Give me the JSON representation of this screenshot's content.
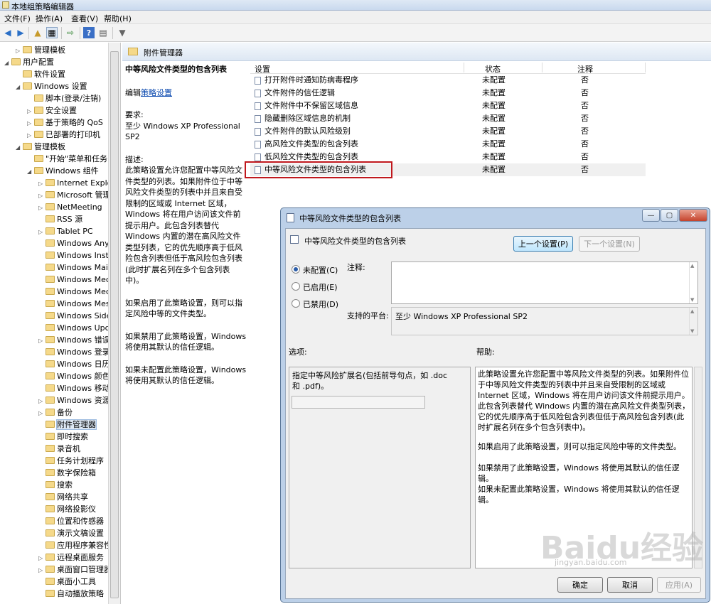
{
  "window": {
    "title": "本地组策略编辑器"
  },
  "menu": [
    "文件(F)",
    "操作(A)",
    "查看(V)",
    "帮助(H)"
  ],
  "toolbar_icons": [
    "back-arrow-icon",
    "forward-arrow-icon",
    "up-folder-icon",
    "show-hide-tree-icon",
    "export-list-icon",
    "help-icon",
    "properties-icon",
    "filter-icon"
  ],
  "tree": [
    {
      "label": "管理模板",
      "level": 1,
      "exp": "▷"
    },
    {
      "label": "用户配置",
      "level": 0,
      "exp": "◢"
    },
    {
      "label": "软件设置",
      "level": 1,
      "exp": ""
    },
    {
      "label": "Windows 设置",
      "level": 1,
      "exp": "◢"
    },
    {
      "label": "脚本(登录/注销)",
      "level": 2,
      "exp": ""
    },
    {
      "label": "安全设置",
      "level": 2,
      "exp": "▷"
    },
    {
      "label": "基于策略的 QoS",
      "level": 2,
      "exp": "▷"
    },
    {
      "label": "已部署的打印机",
      "level": 2,
      "exp": "▷"
    },
    {
      "label": "管理模板",
      "level": 1,
      "exp": "◢"
    },
    {
      "label": "\"开始\"菜单和任务",
      "level": 2,
      "exp": ""
    },
    {
      "label": "Windows 组件",
      "level": 2,
      "exp": "◢"
    },
    {
      "label": "Internet Explor",
      "level": 3,
      "exp": "▷"
    },
    {
      "label": "Microsoft 管理",
      "level": 3,
      "exp": "▷"
    },
    {
      "label": "NetMeeting",
      "level": 3,
      "exp": "▷"
    },
    {
      "label": "RSS 源",
      "level": 3,
      "exp": ""
    },
    {
      "label": "Tablet PC",
      "level": 3,
      "exp": "▷"
    },
    {
      "label": "Windows Anyt",
      "level": 3,
      "exp": ""
    },
    {
      "label": "Windows Insta",
      "level": 3,
      "exp": ""
    },
    {
      "label": "Windows Mail",
      "level": 3,
      "exp": ""
    },
    {
      "label": "Windows Med",
      "level": 3,
      "exp": ""
    },
    {
      "label": "Windows Med",
      "level": 3,
      "exp": ""
    },
    {
      "label": "Windows Mes",
      "level": 3,
      "exp": ""
    },
    {
      "label": "Windows Side",
      "level": 3,
      "exp": ""
    },
    {
      "label": "Windows Upd",
      "level": 3,
      "exp": ""
    },
    {
      "label": "Windows 错误",
      "level": 3,
      "exp": "▷"
    },
    {
      "label": "Windows 登录",
      "level": 3,
      "exp": ""
    },
    {
      "label": "Windows 日历",
      "level": 3,
      "exp": ""
    },
    {
      "label": "Windows 颜色",
      "level": 3,
      "exp": ""
    },
    {
      "label": "Windows 移动",
      "level": 3,
      "exp": ""
    },
    {
      "label": "Windows 资源",
      "level": 3,
      "exp": "▷"
    },
    {
      "label": "备份",
      "level": 3,
      "exp": "▷"
    },
    {
      "label": "附件管理器",
      "level": 3,
      "exp": "",
      "selected": true
    },
    {
      "label": "即时搜索",
      "level": 3,
      "exp": ""
    },
    {
      "label": "录音机",
      "level": 3,
      "exp": ""
    },
    {
      "label": "任务计划程序",
      "level": 3,
      "exp": ""
    },
    {
      "label": "数字保险箱",
      "level": 3,
      "exp": ""
    },
    {
      "label": "搜索",
      "level": 3,
      "exp": ""
    },
    {
      "label": "网络共享",
      "level": 3,
      "exp": ""
    },
    {
      "label": "网络投影仪",
      "level": 3,
      "exp": ""
    },
    {
      "label": "位置和传感器",
      "level": 3,
      "exp": ""
    },
    {
      "label": "演示文稿设置",
      "level": 3,
      "exp": ""
    },
    {
      "label": "应用程序兼容性",
      "level": 3,
      "exp": ""
    },
    {
      "label": "远程桌面服务",
      "level": 3,
      "exp": "▷"
    },
    {
      "label": "桌面窗口管理器",
      "level": 3,
      "exp": "▷"
    },
    {
      "label": "桌面小工具",
      "level": 3,
      "exp": ""
    },
    {
      "label": "自动播放策略",
      "level": 3,
      "exp": ""
    }
  ],
  "right_header": "附件管理器",
  "description": {
    "title": "中等风险文件类型的包含列表",
    "edit_prefix": "编辑",
    "edit_link": "策略设置",
    "req_label": "要求:",
    "req_value": "至少 Windows XP Professional SP2",
    "desc_label": "描述:",
    "desc_text": "此策略设置允许您配置中等风险文件类型的列表。如果附件位于中等风险文件类型的列表中并且来自受限制的区域或 Internet 区域，Windows 将在用户访问该文件前提示用户。此包含列表替代 Windows 内置的潜在高风险文件类型列表，它的优先顺序高于低风险包含列表但低于高风险包含列表(此时扩展名列在多个包含列表中)。",
    "enabled_text": "如果启用了此策略设置，则可以指定风险中等的文件类型。",
    "disabled_text": "如果禁用了此策略设置，Windows 将使用其默认的信任逻辑。",
    "notconf_text": "如果未配置此策略设置，Windows 将使用其默认的信任逻辑。"
  },
  "columns": {
    "setting": "设置",
    "state": "状态",
    "comment": "注释"
  },
  "settings": [
    {
      "name": "打开附件时通知防病毒程序",
      "state": "未配置",
      "comment": "否"
    },
    {
      "name": "文件附件的信任逻辑",
      "state": "未配置",
      "comment": "否"
    },
    {
      "name": "文件附件中不保留区域信息",
      "state": "未配置",
      "comment": "否"
    },
    {
      "name": "隐藏删除区域信息的机制",
      "state": "未配置",
      "comment": "否"
    },
    {
      "name": "文件附件的默认风险级别",
      "state": "未配置",
      "comment": "否"
    },
    {
      "name": "高风险文件类型的包含列表",
      "state": "未配置",
      "comment": "否"
    },
    {
      "name": "低风险文件类型的包含列表",
      "state": "未配置",
      "comment": "否"
    },
    {
      "name": "中等风险文件类型的包含列表",
      "state": "未配置",
      "comment": "否",
      "highlighted": true
    }
  ],
  "dialog": {
    "title": "中等风险文件类型的包含列表",
    "heading": "中等风险文件类型的包含列表",
    "prev_btn": "上一个设置(P)",
    "next_btn": "下一个设置(N)",
    "radio_notconf": "未配置(C)",
    "radio_enabled": "已启用(E)",
    "radio_disabled": "已禁用(D)",
    "selected_radio": "未配置(C)",
    "comment_label": "注释:",
    "comment_value": "",
    "platform_label": "支持的平台:",
    "platform_value": "至少 Windows XP Professional SP2",
    "options_label": "选项:",
    "help_label": "帮助:",
    "option_text": "指定中等风险扩展名(包括前导句点，如 .doc 和 .pdf)。",
    "option_input": "",
    "help_p1": "此策略设置允许您配置中等风险文件类型的列表。如果附件位于中等风险文件类型的列表中并且来自受限制的区域或 Internet 区域，Windows 将在用户访问该文件前提示用户。此包含列表替代 Windows 内置的潜在高风险文件类型列表，它的优先顺序高于低风险包含列表但低于高风险包含列表(此时扩展名列在多个包含列表中)。",
    "help_p2": "如果启用了此策略设置，则可以指定风险中等的文件类型。",
    "help_p3": "如果禁用了此策略设置，Windows 将使用其默认的信任逻辑。",
    "help_p4": "如果未配置此策略设置，Windows 将使用其默认的信任逻辑。",
    "ok_btn": "确定",
    "cancel_btn": "取消",
    "apply_btn": "应用(A)"
  },
  "watermark": {
    "logo": "Baidu经验",
    "url": "jingyan.baidu.com"
  },
  "colors": {
    "highlight_box": "#c0181d",
    "link": "#0645ad",
    "selection": "#dde8f5"
  }
}
